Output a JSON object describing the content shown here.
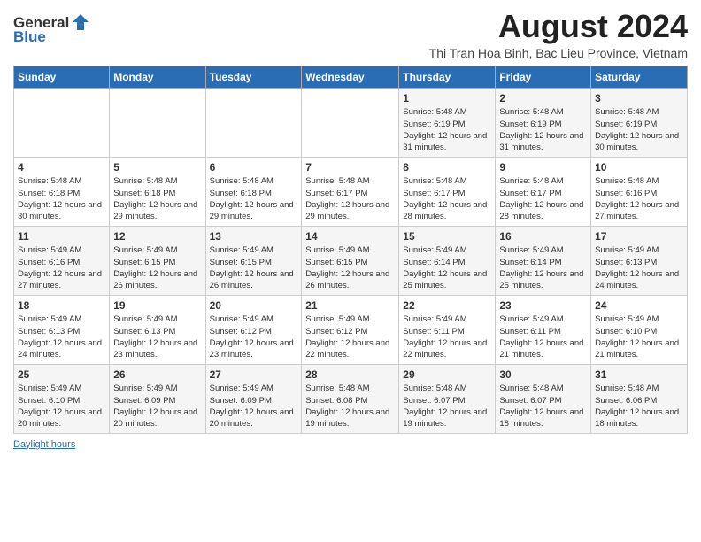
{
  "header": {
    "logo_general": "General",
    "logo_blue": "Blue",
    "month_year": "August 2024",
    "location": "Thi Tran Hoa Binh, Bac Lieu Province, Vietnam"
  },
  "calendar": {
    "days_of_week": [
      "Sunday",
      "Monday",
      "Tuesday",
      "Wednesday",
      "Thursday",
      "Friday",
      "Saturday"
    ],
    "weeks": [
      [
        {
          "day": "",
          "info": ""
        },
        {
          "day": "",
          "info": ""
        },
        {
          "day": "",
          "info": ""
        },
        {
          "day": "",
          "info": ""
        },
        {
          "day": "1",
          "info": "Sunrise: 5:48 AM\nSunset: 6:19 PM\nDaylight: 12 hours and 31 minutes."
        },
        {
          "day": "2",
          "info": "Sunrise: 5:48 AM\nSunset: 6:19 PM\nDaylight: 12 hours and 31 minutes."
        },
        {
          "day": "3",
          "info": "Sunrise: 5:48 AM\nSunset: 6:19 PM\nDaylight: 12 hours and 30 minutes."
        }
      ],
      [
        {
          "day": "4",
          "info": "Sunrise: 5:48 AM\nSunset: 6:18 PM\nDaylight: 12 hours and 30 minutes."
        },
        {
          "day": "5",
          "info": "Sunrise: 5:48 AM\nSunset: 6:18 PM\nDaylight: 12 hours and 29 minutes."
        },
        {
          "day": "6",
          "info": "Sunrise: 5:48 AM\nSunset: 6:18 PM\nDaylight: 12 hours and 29 minutes."
        },
        {
          "day": "7",
          "info": "Sunrise: 5:48 AM\nSunset: 6:17 PM\nDaylight: 12 hours and 29 minutes."
        },
        {
          "day": "8",
          "info": "Sunrise: 5:48 AM\nSunset: 6:17 PM\nDaylight: 12 hours and 28 minutes."
        },
        {
          "day": "9",
          "info": "Sunrise: 5:48 AM\nSunset: 6:17 PM\nDaylight: 12 hours and 28 minutes."
        },
        {
          "day": "10",
          "info": "Sunrise: 5:48 AM\nSunset: 6:16 PM\nDaylight: 12 hours and 27 minutes."
        }
      ],
      [
        {
          "day": "11",
          "info": "Sunrise: 5:49 AM\nSunset: 6:16 PM\nDaylight: 12 hours and 27 minutes."
        },
        {
          "day": "12",
          "info": "Sunrise: 5:49 AM\nSunset: 6:15 PM\nDaylight: 12 hours and 26 minutes."
        },
        {
          "day": "13",
          "info": "Sunrise: 5:49 AM\nSunset: 6:15 PM\nDaylight: 12 hours and 26 minutes."
        },
        {
          "day": "14",
          "info": "Sunrise: 5:49 AM\nSunset: 6:15 PM\nDaylight: 12 hours and 26 minutes."
        },
        {
          "day": "15",
          "info": "Sunrise: 5:49 AM\nSunset: 6:14 PM\nDaylight: 12 hours and 25 minutes."
        },
        {
          "day": "16",
          "info": "Sunrise: 5:49 AM\nSunset: 6:14 PM\nDaylight: 12 hours and 25 minutes."
        },
        {
          "day": "17",
          "info": "Sunrise: 5:49 AM\nSunset: 6:13 PM\nDaylight: 12 hours and 24 minutes."
        }
      ],
      [
        {
          "day": "18",
          "info": "Sunrise: 5:49 AM\nSunset: 6:13 PM\nDaylight: 12 hours and 24 minutes."
        },
        {
          "day": "19",
          "info": "Sunrise: 5:49 AM\nSunset: 6:13 PM\nDaylight: 12 hours and 23 minutes."
        },
        {
          "day": "20",
          "info": "Sunrise: 5:49 AM\nSunset: 6:12 PM\nDaylight: 12 hours and 23 minutes."
        },
        {
          "day": "21",
          "info": "Sunrise: 5:49 AM\nSunset: 6:12 PM\nDaylight: 12 hours and 22 minutes."
        },
        {
          "day": "22",
          "info": "Sunrise: 5:49 AM\nSunset: 6:11 PM\nDaylight: 12 hours and 22 minutes."
        },
        {
          "day": "23",
          "info": "Sunrise: 5:49 AM\nSunset: 6:11 PM\nDaylight: 12 hours and 21 minutes."
        },
        {
          "day": "24",
          "info": "Sunrise: 5:49 AM\nSunset: 6:10 PM\nDaylight: 12 hours and 21 minutes."
        }
      ],
      [
        {
          "day": "25",
          "info": "Sunrise: 5:49 AM\nSunset: 6:10 PM\nDaylight: 12 hours and 20 minutes."
        },
        {
          "day": "26",
          "info": "Sunrise: 5:49 AM\nSunset: 6:09 PM\nDaylight: 12 hours and 20 minutes."
        },
        {
          "day": "27",
          "info": "Sunrise: 5:49 AM\nSunset: 6:09 PM\nDaylight: 12 hours and 20 minutes."
        },
        {
          "day": "28",
          "info": "Sunrise: 5:48 AM\nSunset: 6:08 PM\nDaylight: 12 hours and 19 minutes."
        },
        {
          "day": "29",
          "info": "Sunrise: 5:48 AM\nSunset: 6:07 PM\nDaylight: 12 hours and 19 minutes."
        },
        {
          "day": "30",
          "info": "Sunrise: 5:48 AM\nSunset: 6:07 PM\nDaylight: 12 hours and 18 minutes."
        },
        {
          "day": "31",
          "info": "Sunrise: 5:48 AM\nSunset: 6:06 PM\nDaylight: 12 hours and 18 minutes."
        }
      ]
    ]
  },
  "footer": {
    "label": "Daylight hours"
  }
}
